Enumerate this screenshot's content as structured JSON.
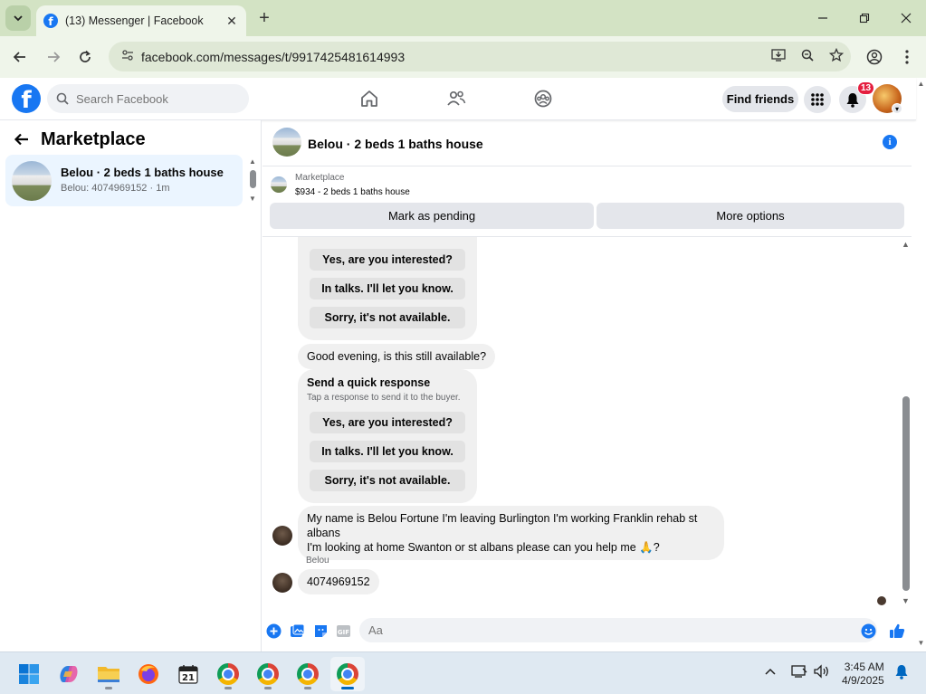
{
  "browser": {
    "tab_title": "(13) Messenger | Facebook",
    "url": "facebook.com/messages/t/9917425481614993"
  },
  "fb_header": {
    "search_placeholder": "Search Facebook",
    "find_friends_label": "Find friends",
    "notification_count": "13"
  },
  "sidebar": {
    "title": "Marketplace",
    "items": [
      {
        "name": "Belou · 2 beds 1 baths house",
        "meta": "Belou: 4074969152 · 1m"
      }
    ]
  },
  "chat": {
    "title": "Belou · 2 beds 1 baths house",
    "listing_label": "Marketplace",
    "listing_price": "$934 - 2 beds 1 baths house",
    "mark_pending_label": "Mark as pending",
    "more_options_label": "More options",
    "quick_response_title": "Send a quick response",
    "quick_response_sub": "Tap a response to send it to the buyer.",
    "quick_responses": [
      "Yes, are you interested?",
      "In talks. I'll let you know.",
      "Sorry, it's not available."
    ],
    "messages": {
      "m1": "Good evening, is this still available?",
      "m2_line1": "My name is Belou Fortune I'm leaving Burlington I'm working Franklin rehab st albans",
      "m2_line2": "I'm looking at home Swanton or st albans  please can you help me 🙏?",
      "sender_name": "Belou",
      "m3": "4074969152"
    },
    "composer_placeholder": "Aa"
  },
  "taskbar": {
    "time": "3:45 AM",
    "date": "4/9/2025",
    "calendar_day": "21"
  },
  "colors": {
    "fb_blue": "#1877f2",
    "bubble_gray": "#f0f0f0",
    "badge_red": "#e41e3f"
  }
}
